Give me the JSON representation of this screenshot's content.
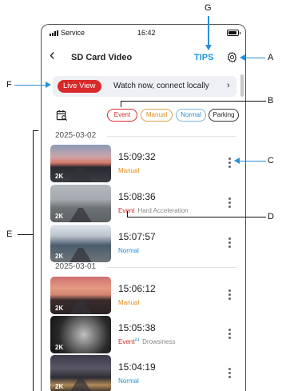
{
  "status_bar": {
    "carrier": "Service",
    "time": "16:42"
  },
  "header": {
    "title": "SD Card Video",
    "tips_label": "TIPS"
  },
  "live_banner": {
    "pill_label": "Live View",
    "message": "Watch now, connect locally"
  },
  "filters": [
    {
      "label": "Event",
      "color": "#d82a2a"
    },
    {
      "label": "Manual",
      "color": "#e08a1a"
    },
    {
      "label": "Normal",
      "color": "#2a8fd0"
    },
    {
      "label": "Parking",
      "color": "#222222"
    }
  ],
  "groups": [
    {
      "date": "2025-03-02",
      "items": [
        {
          "time": "15:09:32",
          "resolution": "2K",
          "type": "Manual",
          "ai": "",
          "description": ""
        },
        {
          "time": "15:08:36",
          "resolution": "2K",
          "type": "Event",
          "ai": "",
          "description": "Hard Acceleration"
        },
        {
          "time": "15:07:57",
          "resolution": "2K",
          "type": "Normal",
          "ai": "",
          "description": ""
        }
      ]
    },
    {
      "date": "2025-03-01",
      "items": [
        {
          "time": "15:06:12",
          "resolution": "2K",
          "type": "Manual",
          "ai": "",
          "description": ""
        },
        {
          "time": "15:05:38",
          "resolution": "2K",
          "type": "Event",
          "ai": "AI",
          "description": "Drowsiness"
        },
        {
          "time": "15:04:19",
          "resolution": "2K",
          "type": "Normal",
          "ai": "",
          "description": ""
        }
      ]
    }
  ],
  "annotations": [
    "A",
    "B",
    "C",
    "D",
    "E",
    "F",
    "G"
  ],
  "colors": {
    "accent": "#1e96e0",
    "event": "#d82a2a",
    "manual": "#e08a1a",
    "normal": "#2a8fd0",
    "callout": "#2b8fd6"
  }
}
